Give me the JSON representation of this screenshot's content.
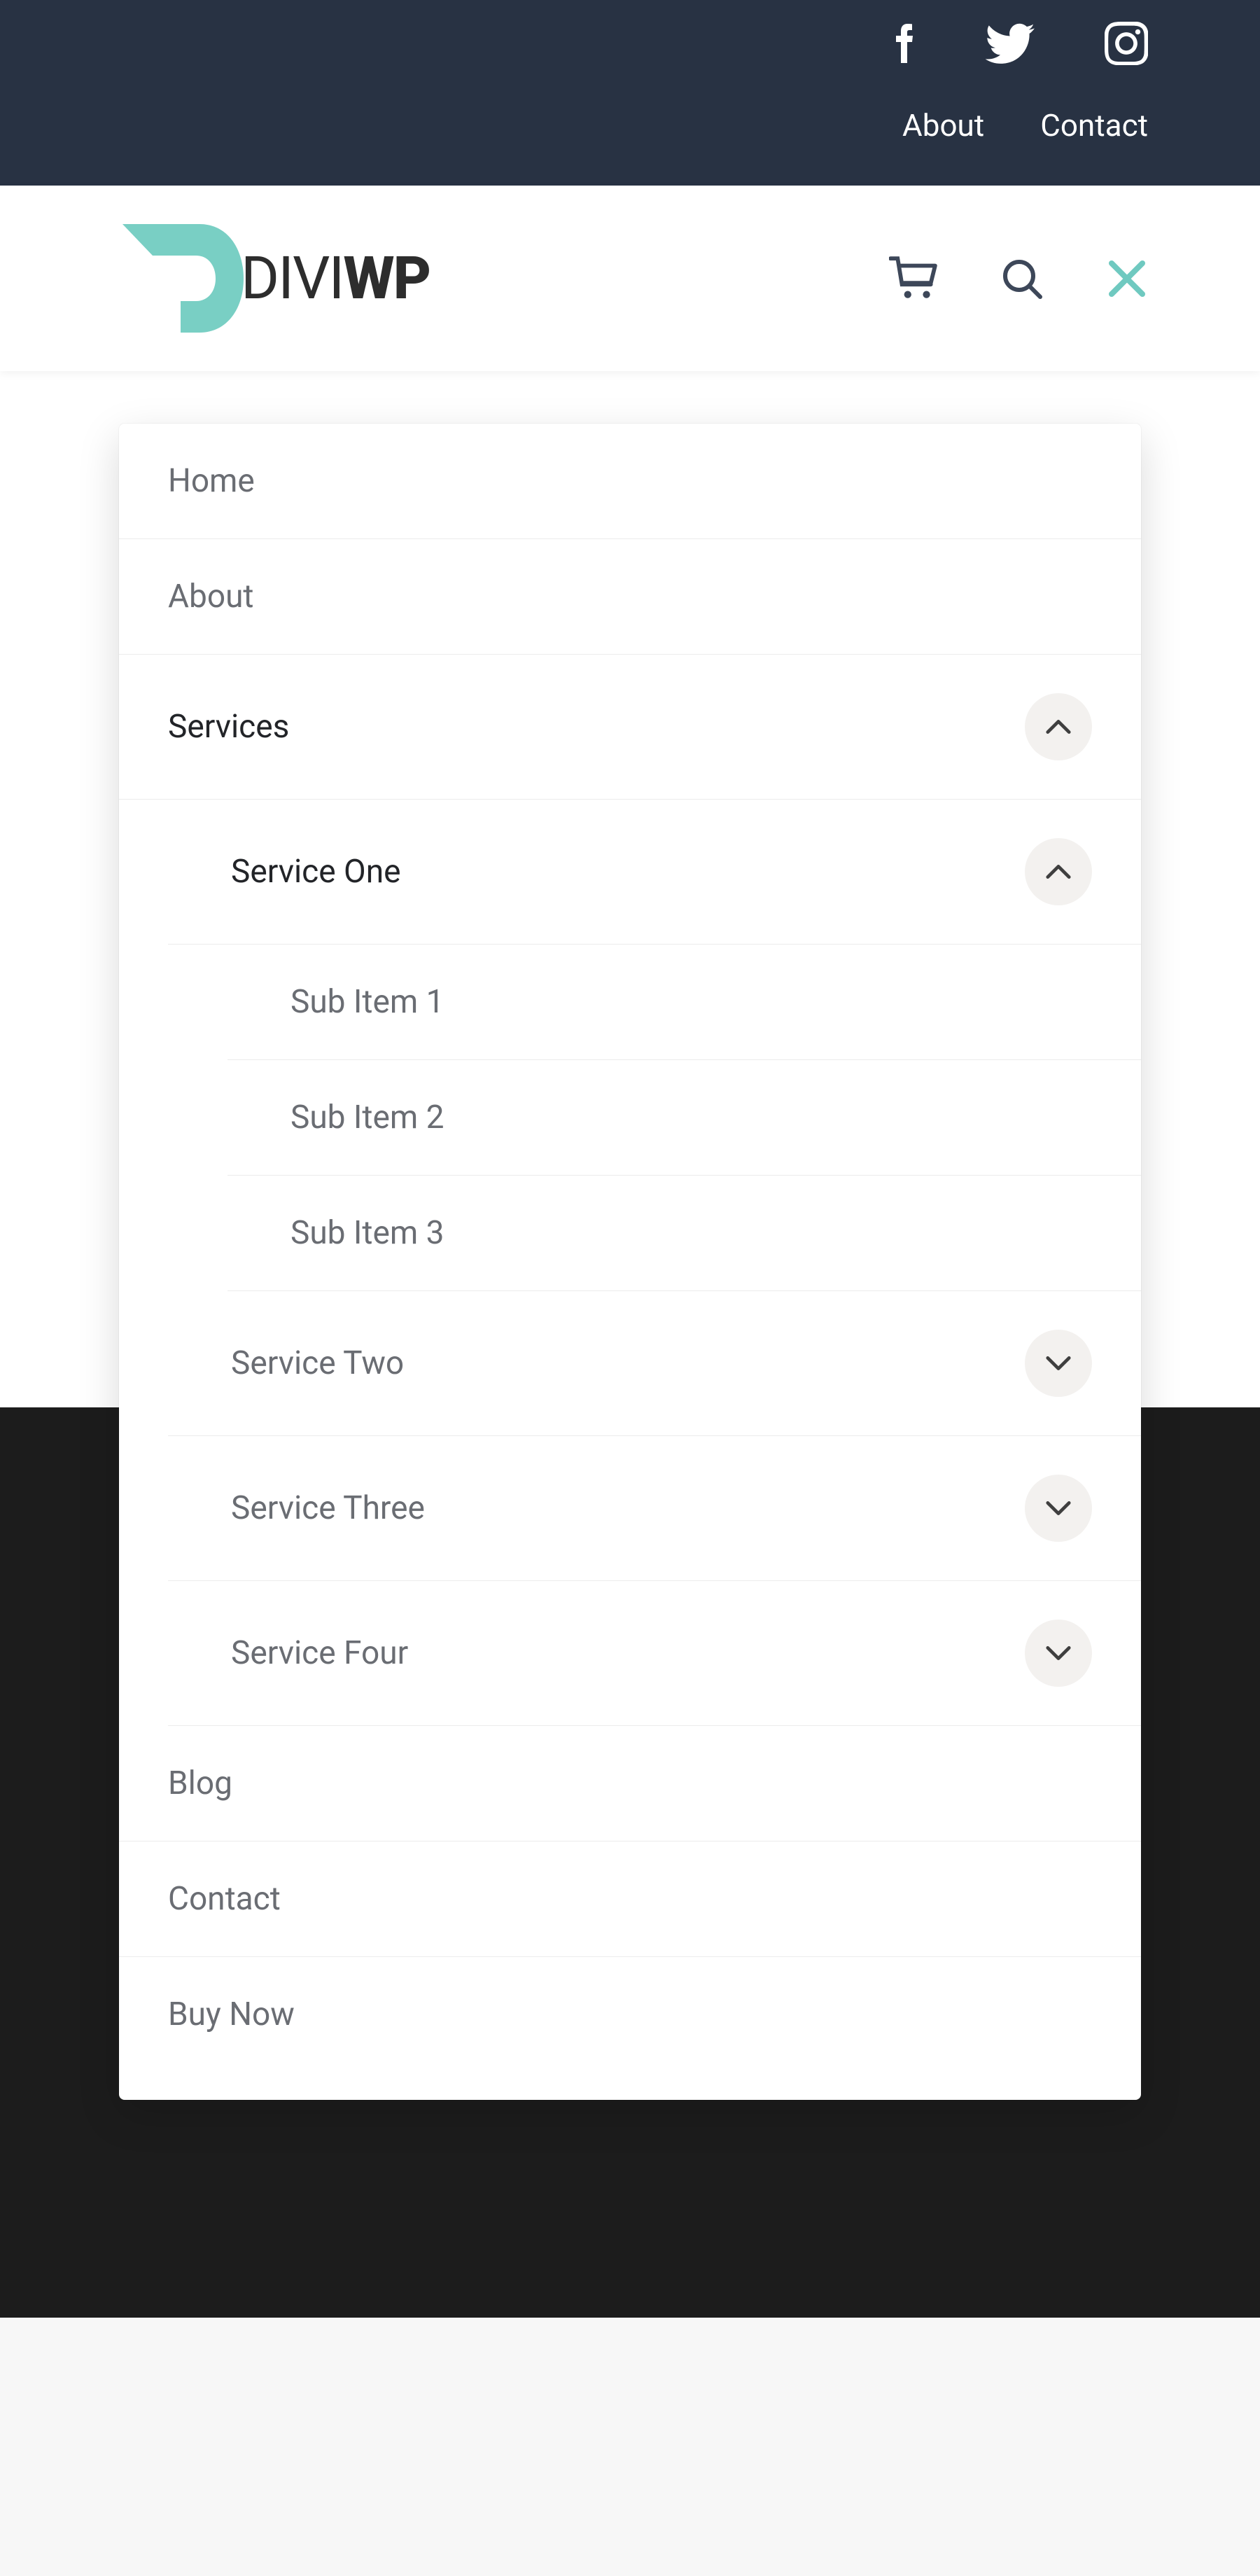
{
  "topbar": {
    "links": [
      "About",
      "Contact"
    ],
    "social": [
      "facebook",
      "twitter",
      "instagram"
    ]
  },
  "logo": {
    "part1": "DIVI",
    "part2": "WP"
  },
  "menu": {
    "home": "Home",
    "about": "About",
    "services": "Services",
    "service_one": "Service One",
    "sub1": "Sub Item 1",
    "sub2": "Sub Item 2",
    "sub3": "Sub Item 3",
    "service_two": "Service Two",
    "service_three": "Service Three",
    "service_four": "Service Four",
    "blog": "Blog",
    "contact": "Contact",
    "buy_now": "Buy Now"
  }
}
